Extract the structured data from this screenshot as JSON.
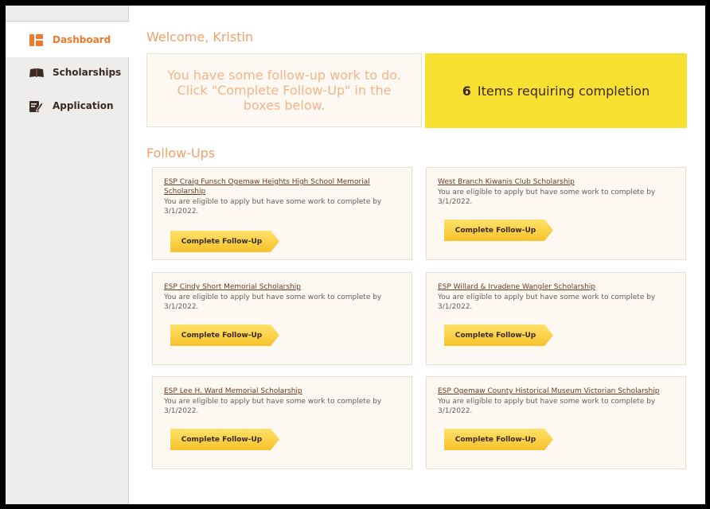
{
  "sidebar": {
    "items": [
      {
        "label": "Dashboard",
        "icon": "dashboard-icon",
        "active": true
      },
      {
        "label": "Scholarships",
        "icon": "open-book-icon",
        "active": false
      },
      {
        "label": "Application",
        "icon": "edit-document-icon",
        "active": false
      }
    ]
  },
  "main": {
    "welcome": "Welcome, Kristin",
    "message": "You have some follow-up work to do. Click \"Complete Follow-Up\" in the boxes below.",
    "count": {
      "number": "6",
      "label": "Items requiring completion"
    },
    "followups_title": "Follow-Ups",
    "cards": [
      {
        "title": "ESP Craig Funsch Ogemaw Heights High School Memorial Scholarship",
        "desc": "You are eligible to apply but have some work to complete by 3/1/2022.",
        "button": "Complete Follow-Up"
      },
      {
        "title": "West Branch Kiwanis Club Scholarship",
        "desc": "You are eligible to apply but have some work to complete by 3/1/2022.",
        "button": "Complete Follow-Up"
      },
      {
        "title": "ESP Cindy Short Memorial Scholarship",
        "desc": "You are eligible to apply but have some work to complete by 3/1/2022.",
        "button": "Complete Follow-Up"
      },
      {
        "title": "ESP Willard & Irvadene Wangler Scholarship",
        "desc": "You are eligible to apply but have some work to complete by 3/1/2022.",
        "button": "Complete Follow-Up"
      },
      {
        "title": "ESP Lee H. Ward Memorial Scholarship",
        "desc": "You are eligible to apply but have some work to complete by 3/1/2022.",
        "button": "Complete Follow-Up"
      },
      {
        "title": "ESP Ogemaw County Historical Museum Victorian Scholarship",
        "desc": "You are eligible to apply but have some work to complete by 3/1/2022.",
        "button": "Complete Follow-Up"
      }
    ]
  },
  "colors": {
    "accent": "#f0782a",
    "highlight": "#f8e030",
    "button": "#f7c12a",
    "text_dark": "#3a2a22"
  }
}
